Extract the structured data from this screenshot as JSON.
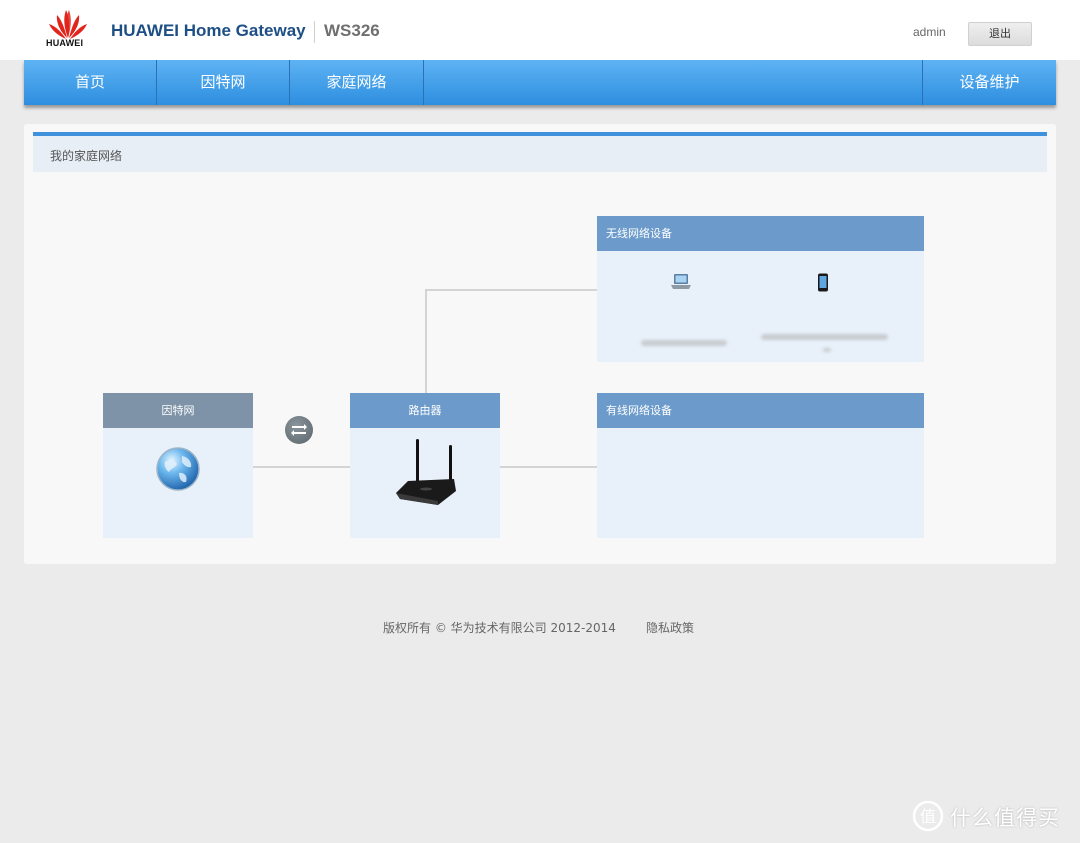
{
  "header": {
    "brand": "HUAWEI",
    "app_title": "HUAWEI Home Gateway",
    "model": "WS326",
    "user": "admin",
    "logout_label": "退出",
    "brand_color": "#e1251b"
  },
  "nav": {
    "items": [
      {
        "label": "首页"
      },
      {
        "label": "因特网"
      },
      {
        "label": "家庭网络"
      },
      {
        "label": "设备维护"
      }
    ]
  },
  "main": {
    "panel_title": "我的家庭网络",
    "internet_card": {
      "title": "因特网",
      "icon": "globe-icon"
    },
    "router_card": {
      "title": "路由器",
      "icon": "router-icon"
    },
    "wireless_card": {
      "title": "无线网络设备",
      "devices": [
        {
          "icon": "laptop-icon"
        },
        {
          "icon": "phone-icon"
        }
      ]
    },
    "wired_card": {
      "title": "有线网络设备"
    },
    "connect_icon": "connection-toggle-icon"
  },
  "footer": {
    "copyright": "版权所有 © 华为技术有限公司 2012-2014",
    "privacy": "隐私政策"
  },
  "watermark": {
    "text": "什么值得买",
    "icon": "zhi-logo-icon"
  }
}
